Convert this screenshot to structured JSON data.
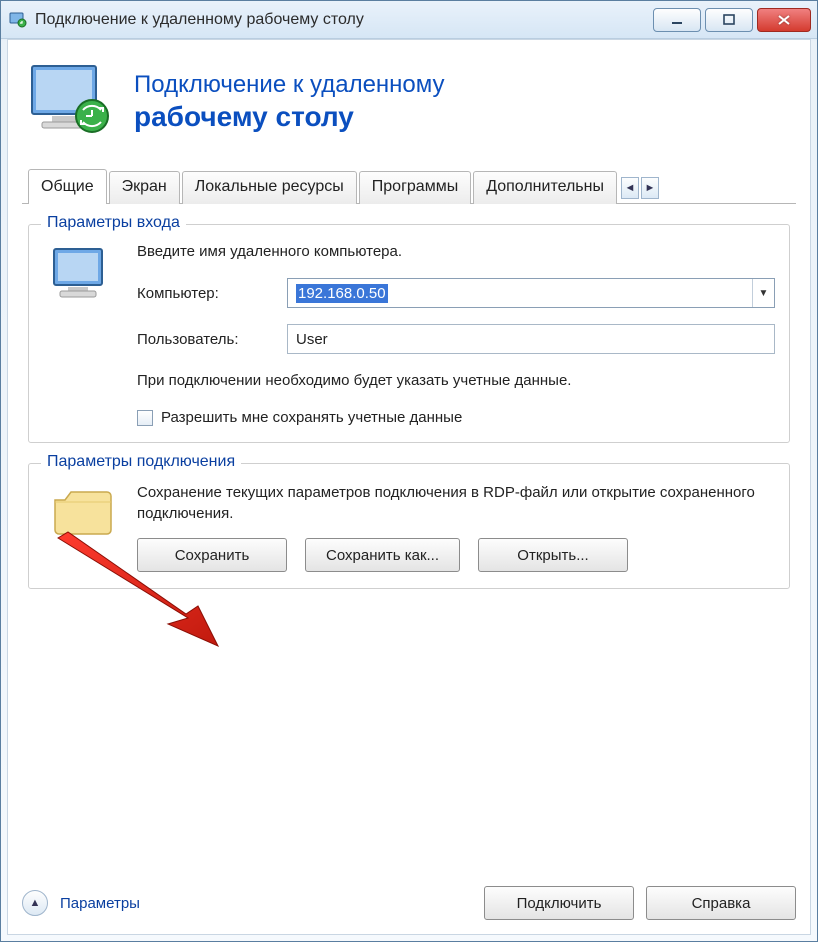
{
  "window": {
    "title": "Подключение к удаленному рабочему столу"
  },
  "header": {
    "line1": "Подключение к удаленному",
    "line2": "рабочему столу"
  },
  "tabs": {
    "items": [
      "Общие",
      "Экран",
      "Локальные ресурсы",
      "Программы",
      "Дополнительны"
    ],
    "active_index": 0
  },
  "login": {
    "group_title": "Параметры входа",
    "instruction": "Введите имя удаленного компьютера.",
    "computer_label": "Компьютер:",
    "computer_value": "192.168.0.50",
    "user_label": "Пользователь:",
    "user_value": "User",
    "hint": "При подключении необходимо будет указать учетные данные.",
    "save_creds_label": "Разрешить мне сохранять учетные данные"
  },
  "connection": {
    "group_title": "Параметры подключения",
    "text": "Сохранение текущих параметров подключения в RDP-файл или открытие сохраненного подключения.",
    "save_label": "Сохранить",
    "save_as_label": "Сохранить как...",
    "open_label": "Открыть..."
  },
  "footer": {
    "options_label": "Параметры",
    "connect_label": "Подключить",
    "help_label": "Справка"
  }
}
